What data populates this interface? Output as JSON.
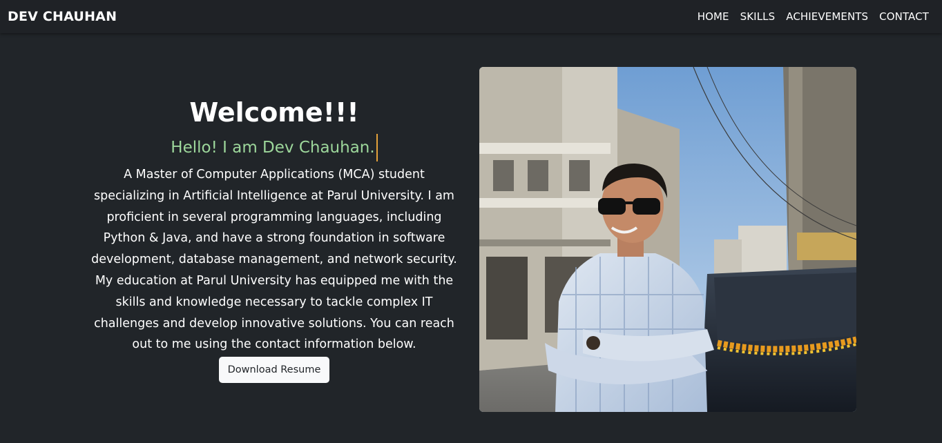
{
  "navbar": {
    "brand": "DEV CHAUHAN",
    "links": [
      {
        "label": "HOME"
      },
      {
        "label": "SKILLS"
      },
      {
        "label": "ACHIEVEMENTS"
      },
      {
        "label": "CONTACT"
      }
    ]
  },
  "hero": {
    "heading": "Welcome!!!",
    "typed_text": "Hello! I am Dev Chauhan.",
    "bio": "A Master of Computer Applications (MCA) student specializing in Artificial Intelligence at Parul University. I am proficient in several programming languages, including Python & Java, and have a strong foundation in software development, database management, and network security. My education at Parul University has equipped me with the skills and knowledge necessary to tackle complex IT challenges and develop innovative solutions. You can reach out to me using the contact information below.",
    "button_label": "Download Resume"
  },
  "colors": {
    "background": "#212529",
    "typed_text": "#9dd79b",
    "cursor": "#e5a23a"
  }
}
